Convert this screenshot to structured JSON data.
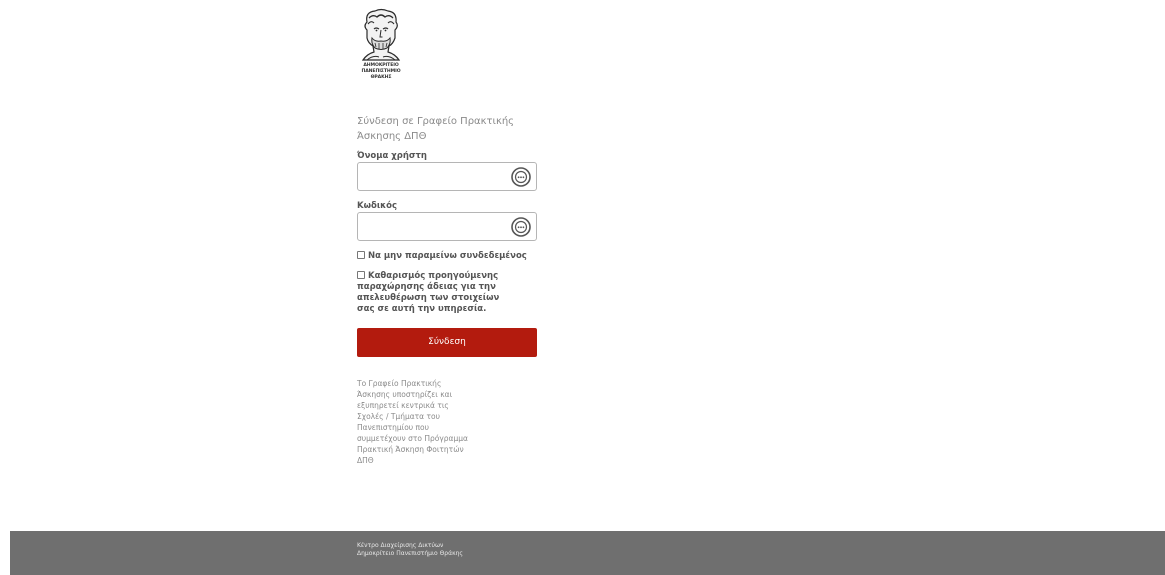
{
  "logo": {
    "line1": "ΔΗΜΟΚΡΙΤΕΙΟ",
    "line2": "ΠΑΝΕΠΙΣΤΗΜΙΟ",
    "line3": "ΘΡΑΚΗΣ"
  },
  "login": {
    "title": "Σύνδεση σε Γραφείο Πρακτικής Άσκησης ΔΠΘ",
    "username_label": "Όνομα χρήστη",
    "username_value": "",
    "password_label": "Κωδικός",
    "password_value": "",
    "remember_label": "Να μην παραμείνω συνδεδεμένος",
    "clear_consent_label": "Καθαρισμός προηγούμενης παραχώρησης άδειας για την απελευθέρωση των στοιχείων σας σε αυτή την υπηρεσία.",
    "submit_label": "Σύνδεση",
    "input_icon": "password-manager-icon"
  },
  "info": {
    "text": "Το Γραφείο Πρακτικής Άσκησης υποστηρίζει και εξυπηρετεί κεντρικά τις Σχολές / Τμήματα του Πανεπιστημίου που συμμετέχουν στο Πρόγραμμα Πρακτική Άσκηση Φοιτητών ΔΠΘ"
  },
  "footer": {
    "line1": "Κέντρο Διαχείρισης Δικτύων",
    "line2": "Δημοκρίτειο Πανεπιστήμιο Θράκης"
  },
  "colors": {
    "accent": "#b31b0e",
    "footer_bg": "#6f6f6f"
  }
}
